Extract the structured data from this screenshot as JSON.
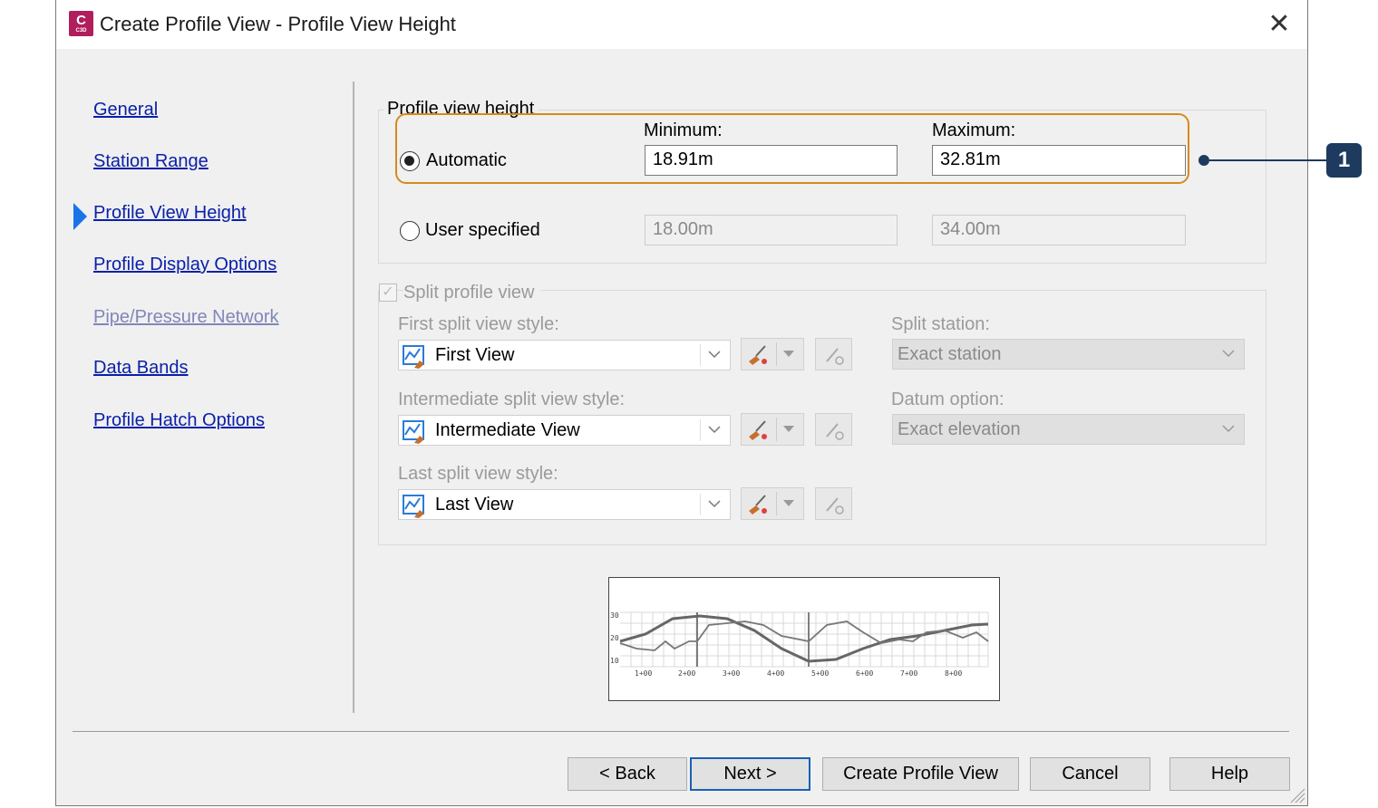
{
  "window": {
    "title": "Create Profile View - Profile View Height",
    "app_icon_letter": "C",
    "app_icon_sub": "C3D",
    "close_glyph": "✕"
  },
  "nav": {
    "items": [
      {
        "label": "General"
      },
      {
        "label": "Station Range"
      },
      {
        "label": "Profile View Height"
      },
      {
        "label": "Profile Display Options"
      },
      {
        "label": "Pipe/Pressure Network"
      },
      {
        "label": "Data Bands"
      },
      {
        "label": "Profile Hatch Options"
      }
    ],
    "active_index": 2,
    "disabled_index": 4
  },
  "height": {
    "group_title": "Profile view height",
    "minimum_label": "Minimum:",
    "maximum_label": "Maximum:",
    "automatic_label": "Automatic",
    "automatic_min": "18.91m",
    "automatic_max": "32.81m",
    "user_label": "User specified",
    "user_min": "18.00m",
    "user_max": "34.00m",
    "selected": "automatic"
  },
  "split": {
    "group_title": "Split profile view",
    "checked": true,
    "first_label": "First split view style:",
    "first_value": "First View",
    "intermediate_label": "Intermediate split view style:",
    "intermediate_value": "Intermediate View",
    "last_label": "Last split view style:",
    "last_value": "Last View",
    "station_label": "Split station:",
    "station_value": "Exact station",
    "datum_label": "Datum option:",
    "datum_value": "Exact elevation"
  },
  "preview": {
    "y_ticks": [
      "30",
      "20",
      "10"
    ],
    "x_ticks": [
      "1+00",
      "2+00",
      "3+00",
      "4+00",
      "5+00",
      "6+00",
      "7+00",
      "8+00"
    ]
  },
  "buttons": {
    "back": "< Back",
    "next": "Next >",
    "create": "Create Profile View",
    "cancel": "Cancel",
    "help": "Help"
  },
  "callout": {
    "number": "1"
  },
  "colors": {
    "highlight": "#d68a1c",
    "callout": "#1e3a5f",
    "link": "#0a20a8",
    "nav_arrow": "#1a73e8",
    "app_icon": "#b01e5c"
  }
}
